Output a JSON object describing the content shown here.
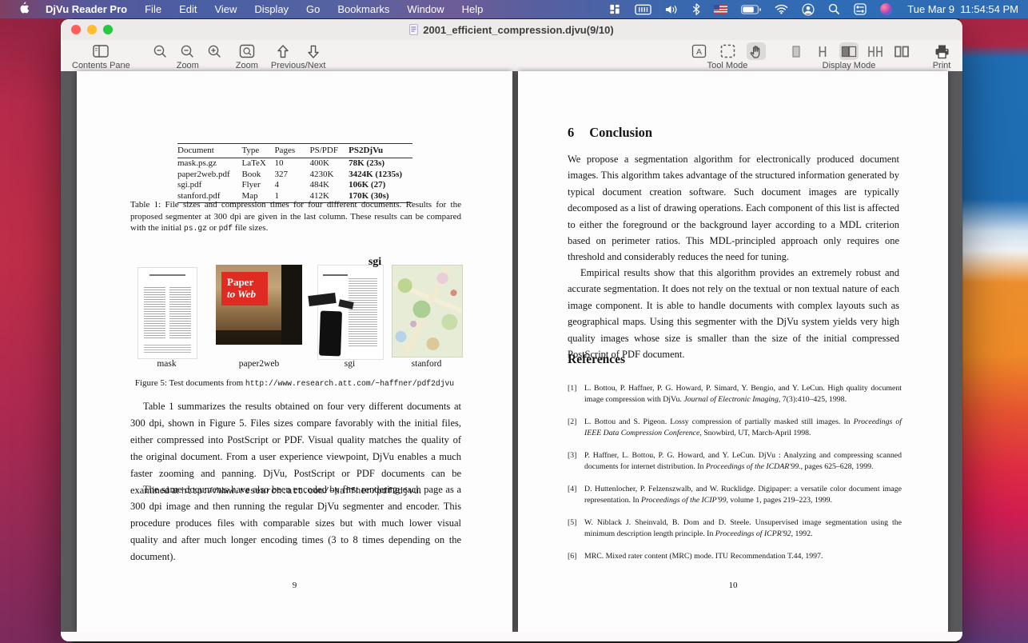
{
  "colors": {
    "traffic_red": "#ff5f57",
    "traffic_yellow": "#febc2e",
    "traffic_green": "#28c840",
    "menubar_blue": "#2f6cb4",
    "wallpaper_red": "#bf2e48",
    "wallpaper_orange": "#ee8b27",
    "content_background": "#59595b",
    "toolbar_background": "#f4f1f1"
  },
  "menubar": {
    "app_name": "DjVu Reader Pro",
    "menus": [
      "File",
      "Edit",
      "View",
      "Display",
      "Go",
      "Bookmarks",
      "Window",
      "Help"
    ],
    "status_icons": [
      "app-layout-icon",
      "keyboard-icon",
      "volume-icon",
      "bluetooth-icon",
      "us-flag-icon",
      "battery-icon",
      "wifi-icon",
      "account-icon",
      "spotlight-search-icon",
      "control-center-icon",
      "siri-icon"
    ],
    "clock": "Tue Mar 9  11:54:54 PM"
  },
  "window": {
    "title": "2001_efficient_compression.djvu(9/10)"
  },
  "toolbar": {
    "contents_pane_label": "Contents Pane",
    "zoom_group_label": "Zoom",
    "zoom_tool_label": "Zoom",
    "prev_next_label": "Previous/Next",
    "tool_mode_label": "Tool Mode",
    "display_mode_label": "Display Mode",
    "print_label": "Print"
  },
  "left_page": {
    "page_number": "9",
    "table": {
      "headers": [
        "Document",
        "Type",
        "Pages",
        "PS/PDF",
        "PS2DjVu"
      ],
      "rows": [
        [
          "mask.ps.gz",
          "LaTeX",
          "10",
          "400K",
          "78K (23s)"
        ],
        [
          "paper2web.pdf",
          "Book",
          "327",
          "4230K",
          "3424K (1235s)"
        ],
        [
          "sgi.pdf",
          "Flyer",
          "4",
          "484K",
          "106K (27)"
        ],
        [
          "stanford.pdf",
          "Map",
          "1",
          "412K",
          "170K (30s)"
        ]
      ]
    },
    "table_caption": {
      "pre": "Table 1: File sizes and compression times for four different documents. Results for the proposed segmenter at 300 dpi are given in the last column. These results can be compared with the initial ",
      "mono1": "ps.gz",
      "mid": " or ",
      "mono2": "pdf",
      "post": " file sizes."
    },
    "figure": {
      "cover_title_line1": "Paper",
      "cover_title_line2": "to Web",
      "sgi_logo": "sgi",
      "labels": [
        "mask",
        "paper2web",
        "sgi",
        "stanford"
      ],
      "caption_pre": "Figure 5: Test documents from ",
      "caption_url": "http://www.research.att.com/~haffner/pdf2djvu"
    },
    "para1_pre": "Table 1 summarizes the results obtained on four very different documents at 300 dpi, shown in Figure 5. Files sizes compare favorably with the initial files, either compressed into PostScript or PDF. Visual quality matches the quality of the original document. From a user experience viewpoint, DjVu enables a much faster zooming and panning. DjVu, PostScript or PDF documents can be examined at ",
    "para1_url": "http://www.research.att.com/~haffner/pdf2djvu",
    "para1_post": ".",
    "para2": "The same documents have also been encoded by first rendering each page as a 300 dpi image and then running the regular DjVu segmenter and encoder. This procedure produces files with comparable sizes but with much lower visual quality and after much longer encoding times (3 to 8 times depending on the document)."
  },
  "right_page": {
    "page_number": "10",
    "section_number": "6",
    "section_title": "Conclusion",
    "para1": "We propose a segmentation algorithm for electronically produced document images. This algorithm takes advantage of the structured information generated by typical document creation software. Such document images are typically decomposed as a list of drawing operations. Each component of this list is affected to either the foreground or the background layer according to a MDL criterion based on perimeter ratios. This MDL-principled approach only requires one threshold and considerably reduces the need for tuning.",
    "para2": "Empirical results show that this algorithm provides an extremely robust and accurate segmentation. It does not rely on the textual or non textual nature of each image component. It is able to handle documents with complex layouts such as geographical maps. Using this segmenter with the DjVu system yields very high quality images whose size is smaller than the size of the initial compressed PostScript of PDF document.",
    "references_title": "References",
    "references": [
      {
        "num": "[1]",
        "pre": "L. Bottou, P. Haffner, P. G. Howard, P. Simard, Y. Bengio, and Y. LeCun. High quality document image compression with DjVu. ",
        "italic": "Journal of Electronic Imaging",
        "post": ", 7(3):410–425, 1998."
      },
      {
        "num": "[2]",
        "pre": "L. Bottou and S. Pigeon. Lossy compression of partially masked still images. In ",
        "italic": "Proceedings of IEEE Data Compression Conference",
        "post": ", Snowbird, UT, March-April 1998."
      },
      {
        "num": "[3]",
        "pre": "P. Haffner, L. Bottou, P. G. Howard, and Y. LeCun. DjVu : Analyzing and compressing scanned documents for internet distribution. In ",
        "italic": "Proceedings of the ICDAR'99.",
        "post": ", pages 625–628, 1999."
      },
      {
        "num": "[4]",
        "pre": "D. Huttenlocher, P. Felzenszwalb, and W. Rucklidge. Digipaper: a versatile color document image representation. In ",
        "italic": "Proceedings of the ICIP'99",
        "post": ", volume 1, pages 219–223, 1999."
      },
      {
        "num": "[5]",
        "pre": "W. Niblack J. Sheinvald, B. Dom and D. Steele. Unsupervised image segmentation using the minimum description length principle. In ",
        "italic": "Proceedings of ICPR'92",
        "post": ", 1992."
      },
      {
        "num": "[6]",
        "pre": "MRC. Mixed rater content (MRC) mode. ITU Recommendation T.44, 1997.",
        "italic": "",
        "post": ""
      }
    ]
  }
}
